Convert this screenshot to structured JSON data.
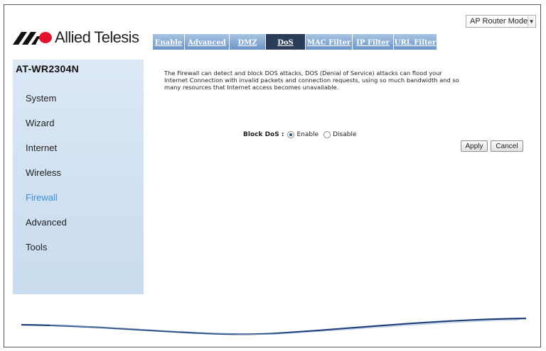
{
  "header": {
    "brand": "Allied Telesis",
    "mode_select": {
      "value": "AP Router Mode"
    }
  },
  "tabs": [
    {
      "label": "Enable",
      "active": false
    },
    {
      "label": "Advanced",
      "active": false
    },
    {
      "label": "DMZ",
      "active": false
    },
    {
      "label": "DoS",
      "active": true
    },
    {
      "label": "MAC Filter",
      "active": false
    },
    {
      "label": "IP Filter",
      "active": false
    },
    {
      "label": "URL Filter",
      "active": false
    }
  ],
  "sidebar": {
    "model": "AT-WR2304N",
    "items": [
      {
        "label": "System",
        "active": false
      },
      {
        "label": "Wizard",
        "active": false
      },
      {
        "label": "Internet",
        "active": false
      },
      {
        "label": "Wireless",
        "active": false
      },
      {
        "label": "Firewall",
        "active": true
      },
      {
        "label": "Advanced",
        "active": false
      },
      {
        "label": "Tools",
        "active": false
      }
    ]
  },
  "content": {
    "description_lines": [
      "The Firewall can detect and block DOS attacks, DOS (Denial of Service) attacks can flood your",
      "Internet Connection with invalid packets and connection requests, using so much bandwidth and so",
      "many resources that Internet access becomes unavailable."
    ],
    "block_dos": {
      "label": "Block DoS :",
      "options": [
        {
          "label": "Enable",
          "checked": true
        },
        {
          "label": "Disable",
          "checked": false
        }
      ]
    },
    "apply_label": "Apply",
    "cancel_label": "Cancel"
  },
  "colors": {
    "active_tab": "#2a3c57",
    "tab": "#7ea5d3",
    "sidebar_bg": "#d6e4f3",
    "active_menu": "#3b8fd8",
    "logo_red": "#e0142f"
  }
}
